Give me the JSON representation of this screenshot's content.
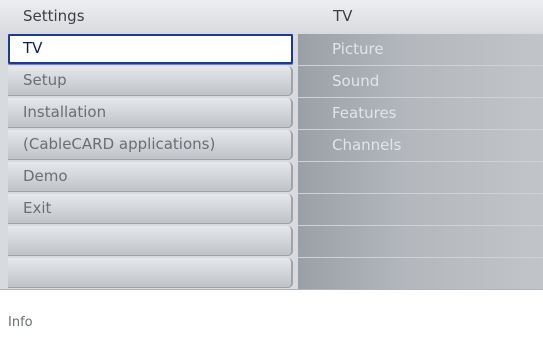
{
  "header": {
    "left_title": "Settings",
    "right_title": "TV"
  },
  "left_menu": {
    "items": [
      {
        "label": "TV",
        "selected": true
      },
      {
        "label": "Setup"
      },
      {
        "label": "Installation"
      },
      {
        "label": "(CableCARD applications)"
      },
      {
        "label": "Demo"
      },
      {
        "label": "Exit"
      },
      {
        "label": ""
      },
      {
        "label": ""
      }
    ]
  },
  "right_menu": {
    "items": [
      {
        "label": "Picture"
      },
      {
        "label": "Sound"
      },
      {
        "label": "Features"
      },
      {
        "label": "Channels"
      },
      {
        "label": ""
      },
      {
        "label": ""
      },
      {
        "label": ""
      },
      {
        "label": ""
      }
    ]
  },
  "info": {
    "label": "Info"
  },
  "colors": {
    "selection_border": "#1d3a8f",
    "selected_text": "#0c1d5c",
    "panel_background": "#d8dade"
  }
}
